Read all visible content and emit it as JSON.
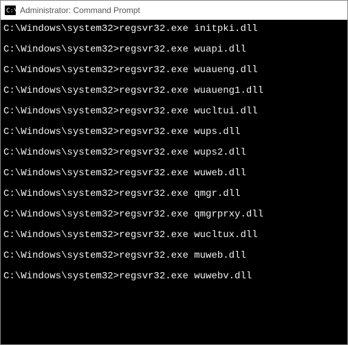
{
  "window": {
    "title": "Administrator: Command Prompt"
  },
  "terminal": {
    "prompt": "C:\\Windows\\system32>",
    "command": "regsvr32.exe",
    "lines": [
      {
        "arg": "initpki.dll"
      },
      {
        "arg": "wuapi.dll"
      },
      {
        "arg": "wuaueng.dll"
      },
      {
        "arg": "wuaueng1.dll"
      },
      {
        "arg": "wucltui.dll"
      },
      {
        "arg": "wups.dll"
      },
      {
        "arg": "wups2.dll"
      },
      {
        "arg": "wuweb.dll"
      },
      {
        "arg": "qmgr.dll"
      },
      {
        "arg": "qmgrprxy.dll"
      },
      {
        "arg": "wucltux.dll"
      },
      {
        "arg": "muweb.dll"
      },
      {
        "arg": "wuwebv.dll"
      }
    ]
  }
}
